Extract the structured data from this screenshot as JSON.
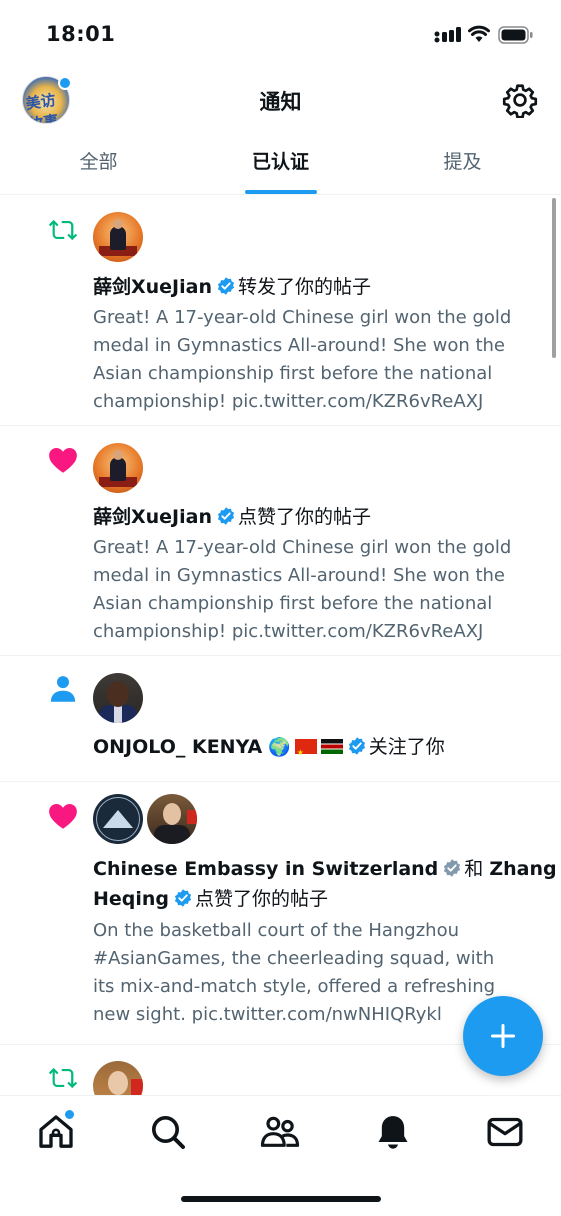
{
  "status_bar": {
    "time": "18:01"
  },
  "header": {
    "title": "通知",
    "avatar_logo": "美访故事"
  },
  "tabs": [
    {
      "label": "全部",
      "active": false
    },
    {
      "label": "已认证",
      "active": true
    },
    {
      "label": "提及",
      "active": false
    }
  ],
  "notifications": [
    {
      "type_icon": "retweet-icon",
      "actor": "薛剑XueJian",
      "action": "转发了你的帖子",
      "text": [
        "Great! A 17-year-old Chinese girl won the gold",
        "medal in Gymnastics All-around! She won the",
        "Asian championship first before the national",
        "championship! pic.twitter.com/KZR6vReAXJ"
      ]
    },
    {
      "type_icon": "heart-icon",
      "actor": "薛剑XueJian",
      "action": "点赞了你的帖子",
      "text": [
        "Great! A 17-year-old Chinese girl won the gold",
        "medal in Gymnastics All-around! She won the",
        "Asian championship first before the national",
        "championship! pic.twitter.com/KZR6vReAXJ"
      ]
    },
    {
      "type_icon": "person-icon",
      "actor": "ONJOLO_ KENYA",
      "globe": "🌍",
      "action": "关注了你"
    },
    {
      "type_icon": "heart-icon",
      "actor": "Chinese Embassy in Switzerland",
      "conjunction": "和",
      "actor2_part1": "Zhang",
      "actor2_part2": "Heqing",
      "action": "点赞了你的帖子",
      "text": [
        "On the basketball court of the Hangzhou",
        "#AsianGames, the cheerleading squad, with",
        "its mix-and-match style, offered a refreshing",
        "new sight. pic.twitter.com/nwNHIQRykl"
      ]
    },
    {
      "type_icon": "retweet-icon"
    }
  ],
  "fab": {
    "icon": "plus-icon"
  },
  "bottom_nav": [
    "home-icon",
    "search-icon",
    "communities-icon",
    "bell-icon",
    "mail-icon"
  ],
  "colors": {
    "accent": "#1d9bf0",
    "retweet": "#00ba7c",
    "like": "#f91880",
    "text_secondary": "#536471",
    "verified_gray": "#829aab"
  }
}
